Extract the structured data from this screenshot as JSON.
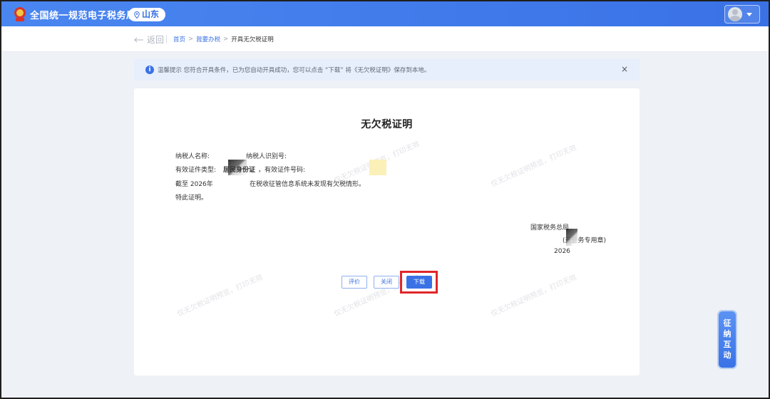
{
  "header": {
    "site_title": "全国统一规范电子税务局",
    "region": "山东"
  },
  "breadcrumb": {
    "back_label": "返回",
    "home": "首页",
    "my_tax": "我要办税",
    "current": "开具无欠税证明"
  },
  "tip": {
    "icon_glyph": "i",
    "text": "温馨提示 您符合开具条件，已为您自动开具成功，您可以点击 “下载” 将《无欠税证明》保存到本地。",
    "close": "×"
  },
  "document": {
    "title": "无欠税证明",
    "taxpayer_name_label": "纳税人名称:",
    "taxpayer_id_label": "纳税人识别号:",
    "cert_type_label": "有效证件类型:",
    "cert_type_value": "居民身份证",
    "cert_no_label": "，有效证件号码:",
    "as_of_label": "截至 2026年",
    "as_of_text": "在税收征管信息系统未发现有欠税情形。",
    "closing": "特此证明。",
    "issuer": "国家税务总局",
    "seal_note": "(盖业务专用章)",
    "issue_year": "2026",
    "watermark": "仅无欠税证明预览，打印无效"
  },
  "actions": {
    "rate": "评价",
    "close": "关闭",
    "download": "下载"
  },
  "float_widget": [
    "征",
    "纳",
    "互",
    "动"
  ],
  "colors": {
    "primary": "#3a72e6",
    "highlight": "#e0262a"
  }
}
